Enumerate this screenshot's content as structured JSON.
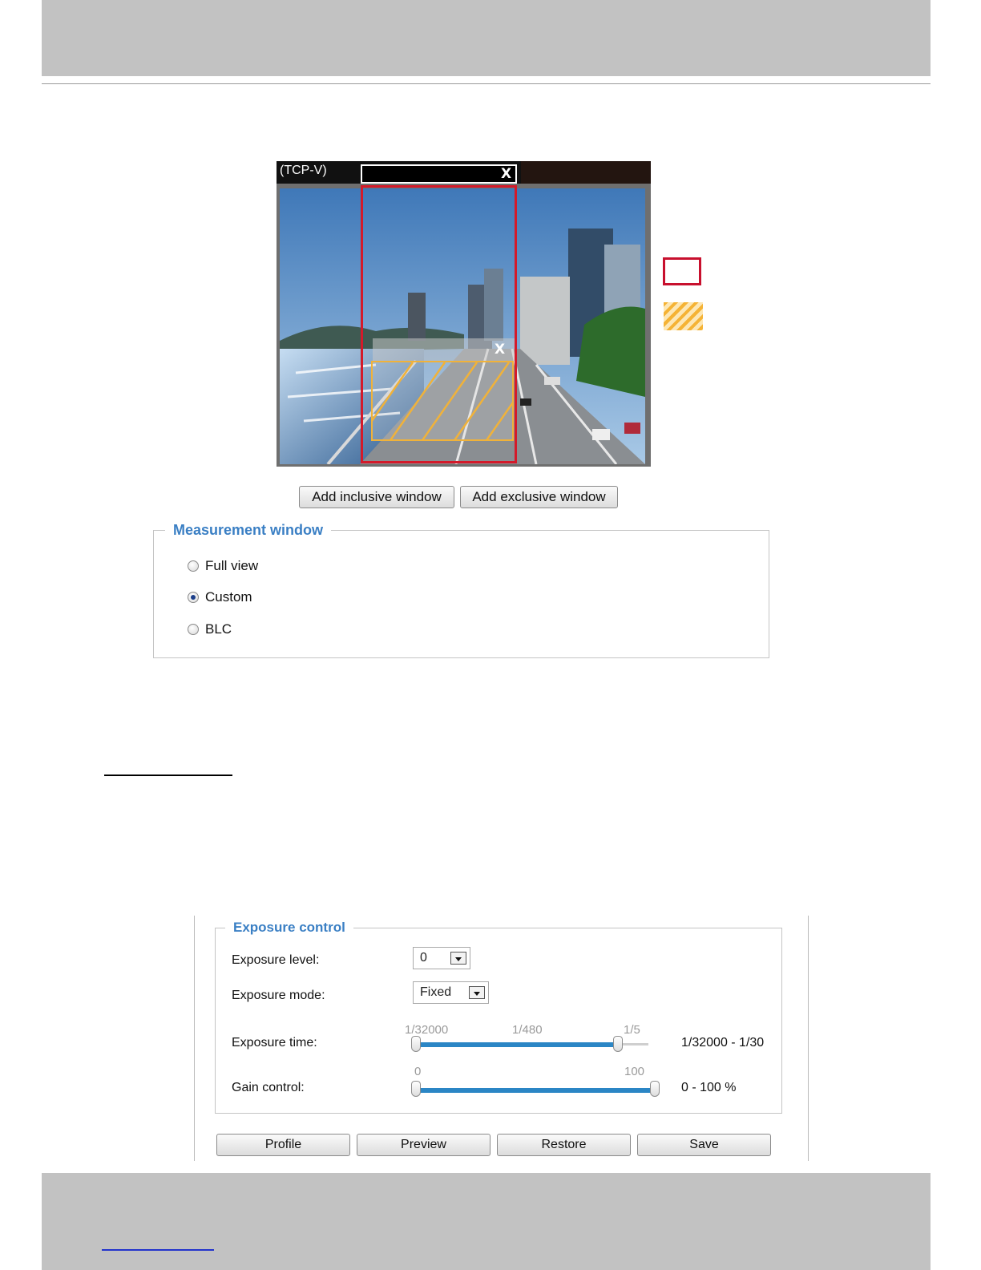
{
  "video": {
    "title": "(TCP-V)",
    "close_glyph": "X"
  },
  "buttons": {
    "add_inclusive": "Add inclusive window",
    "add_exclusive": "Add exclusive window"
  },
  "measurement": {
    "legend": "Measurement window",
    "options": [
      {
        "label": "Full view",
        "selected": false
      },
      {
        "label": "Custom",
        "selected": true
      },
      {
        "label": "BLC",
        "selected": false
      }
    ]
  },
  "exposure": {
    "legend": "Exposure control",
    "level_label": "Exposure level:",
    "level_value": "0",
    "mode_label": "Exposure mode:",
    "mode_value": "Fixed",
    "time_label": "Exposure time:",
    "time_ticks": [
      "1/32000",
      "1/480",
      "1/5"
    ],
    "time_range": "1/32000 - 1/30",
    "time_fill_fraction": 0.87,
    "gain_label": "Gain control:",
    "gain_ticks": [
      "0",
      "100"
    ],
    "gain_range": "0 - 100 %",
    "gain_fill_fraction": 1.0
  },
  "actions": {
    "profile": "Profile",
    "preview": "Preview",
    "restore": "Restore",
    "save": "Save"
  },
  "colors": {
    "legend_blue": "#3a7fc4",
    "inclusive_red": "#d41a2a",
    "exclusive_amber": "#f0b23a",
    "slider_blue": "#2b86c5"
  }
}
